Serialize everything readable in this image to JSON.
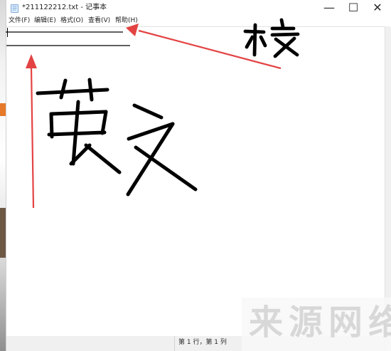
{
  "window": {
    "title": "*211122212.txt - 记事本",
    "controls": {
      "minimize": "—",
      "maximize": "☐",
      "close": "✕"
    }
  },
  "menu": {
    "file": "文件(F)",
    "edit": "编辑(E)",
    "format": "格式(O)",
    "view": "查看(V)",
    "help": "帮助(H)"
  },
  "editor": {
    "text": ""
  },
  "status": {
    "cursor_position": "第 1 行，第 1 列"
  },
  "handwriting": {
    "top_right": "校",
    "center": "英文"
  },
  "watermark": {
    "text": "来源网络"
  },
  "colors": {
    "accent_red": "#e44343",
    "ink": "#000000",
    "watermark": "#d8d8d8",
    "status_bar": "#f0f0f0"
  },
  "icons": {
    "app": "notepad-icon",
    "minimize": "minimize-icon",
    "maximize": "maximize-icon",
    "close": "close-icon"
  }
}
